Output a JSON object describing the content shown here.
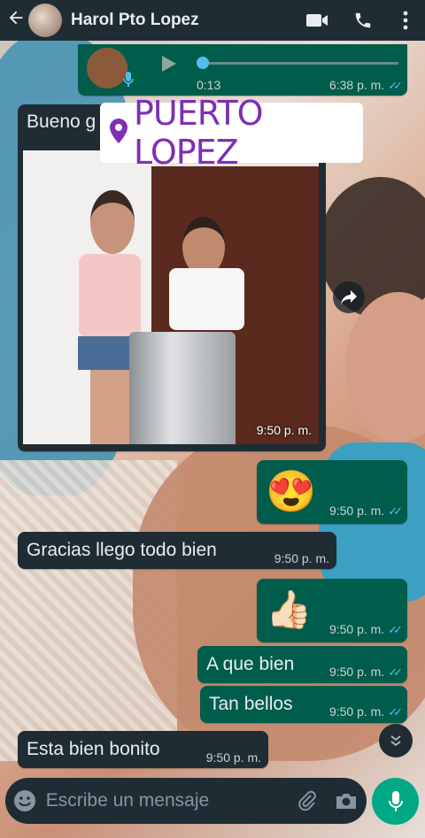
{
  "header": {
    "contact_name": "Harol Pto Lopez",
    "back_icon": "arrow-left-icon",
    "video_icon": "video-camera-icon",
    "call_icon": "phone-icon",
    "menu_icon": "kebab-menu-icon"
  },
  "voice_note": {
    "duration": "0:13",
    "time": "6:38 p. m.",
    "progress": 0.0
  },
  "partial_message": {
    "text": "Bueno g"
  },
  "sticker": {
    "text": "PUERTO LOPEZ",
    "icon": "location-pin-icon"
  },
  "photo_message": {
    "time": "9:50 p. m."
  },
  "messages": [
    {
      "type": "out",
      "text": "😍",
      "time": "9:50 p. m."
    },
    {
      "type": "in",
      "text": "Gracias llego todo bien",
      "time": "9:50 p. m."
    },
    {
      "type": "out",
      "text": "👍🏻",
      "time": "9:50 p. m."
    },
    {
      "type": "out",
      "text": "A que bien",
      "time": "9:50 p. m."
    },
    {
      "type": "out",
      "text": "Tan bellos",
      "time": "9:50 p. m."
    },
    {
      "type": "in",
      "text": "Esta bien bonito",
      "time": "9:50 p. m."
    }
  ],
  "composer": {
    "placeholder": "Escribe un mensaje",
    "emoji_icon": "emoji-icon",
    "attach_icon": "paperclip-icon",
    "camera_icon": "camera-icon",
    "mic_icon": "microphone-icon"
  },
  "colors": {
    "header_bg": "#1f2c34",
    "outgoing_bubble": "#005c4b",
    "incoming_bubble": "#1f2c34",
    "read_ticks": "#53bdeb",
    "mic_button": "#00a884",
    "sticker_text": "#7d2fb5"
  }
}
